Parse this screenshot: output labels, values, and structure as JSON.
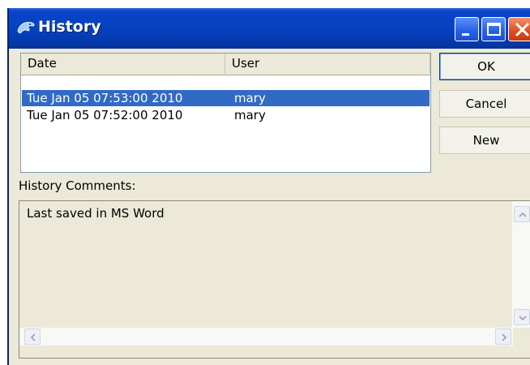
{
  "window": {
    "title": "History",
    "icon": "history-dolphin-icon"
  },
  "titlebar_buttons": [
    {
      "name": "minimize",
      "icon": "minimize-icon"
    },
    {
      "name": "maximize",
      "icon": "maximize-icon"
    },
    {
      "name": "close",
      "icon": "close-icon"
    }
  ],
  "history_list": {
    "columns": [
      "Date",
      "User"
    ],
    "rows": [
      {
        "date": "Tue Jan 05 07:53:00 2010",
        "user": "mary",
        "selected": true
      },
      {
        "date": "Tue Jan 05 07:52:00 2010",
        "user": "mary",
        "selected": false
      }
    ]
  },
  "buttons": {
    "ok": "OK",
    "cancel": "Cancel",
    "new": "New"
  },
  "comments": {
    "label": "History Comments:",
    "text": "Last saved in MS Word"
  },
  "colors": {
    "titlebar": "#0542c0",
    "selection": "#316ac5",
    "dialog_bg": "#ece9d8",
    "close_button": "#de4d22"
  }
}
